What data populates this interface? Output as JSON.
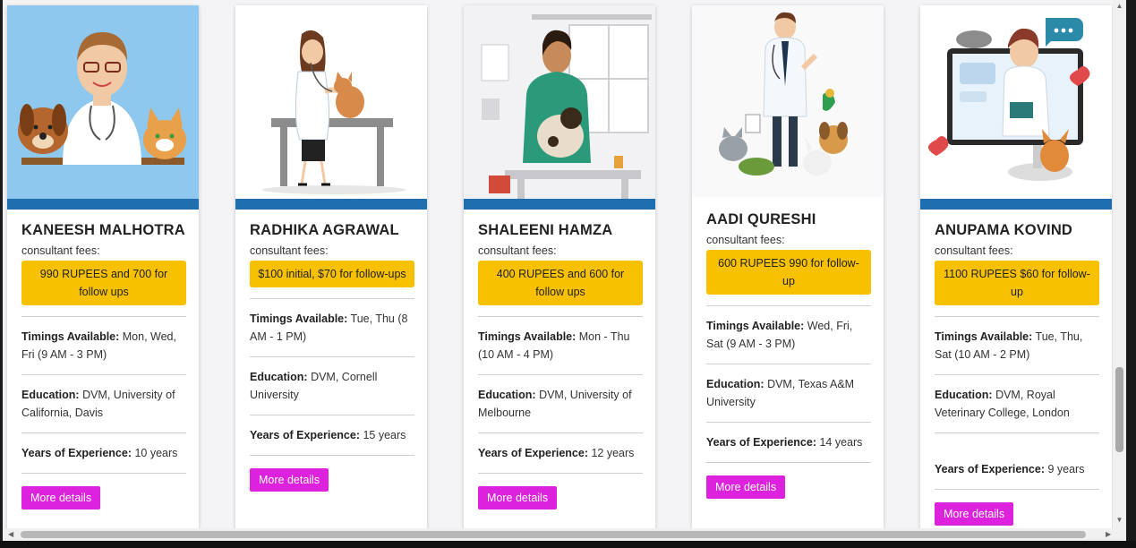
{
  "cards": [
    {
      "name": "KANEESH MALHOTRA",
      "fees_label": "consultant fees:",
      "fees": "990 RUPEES and 700 for follow ups",
      "timings_label": "Timings Available:",
      "timings": " Mon, Wed, Fri (9 AM - 3 PM)",
      "education_label": "Education:",
      "education": " DVM, University of California, Davis",
      "experience_label": "Years of Experience:",
      "experience": " 10 years",
      "button": "More details"
    },
    {
      "name": "RADHIKA AGRAWAL",
      "fees_label": "consultant fees:",
      "fees": "$100 initial, $70 for follow-ups",
      "timings_label": "Timings Available:",
      "timings": " Tue, Thu (8 AM - 1 PM)",
      "education_label": "Education:",
      "education": " DVM, Cornell University",
      "experience_label": "Years of Experience:",
      "experience": " 15 years",
      "button": "More details"
    },
    {
      "name": "SHALEENI HAMZA",
      "fees_label": "consultant fees:",
      "fees": "400 RUPEES and 600 for follow ups",
      "timings_label": "Timings Available:",
      "timings": " Mon - Thu (10 AM - 4 PM)",
      "education_label": "Education:",
      "education": " DVM, University of Melbourne",
      "experience_label": "Years of Experience:",
      "experience": " 12 years",
      "button": "More details"
    },
    {
      "name": "AADI QURESHI",
      "fees_label": "consultant fees:",
      "fees": "600 RUPEES 990 for follow-up",
      "timings_label": "Timings Available:",
      "timings": " Wed, Fri, Sat (9 AM - 3 PM)",
      "education_label": "Education:",
      "education": " DVM, Texas A&M University",
      "experience_label": "Years of Experience:",
      "experience": " 14 years",
      "button": "More details"
    },
    {
      "name": "ANUPAMA KOVIND",
      "fees_label": "consultant fees:",
      "fees": "1100 RUPEES $60 for follow-up",
      "timings_label": "Timings Available:",
      "timings": " Tue, Thu, Sat (10 AM - 2 PM)",
      "education_label": "Education:",
      "education": " DVM, Royal Veterinary College, London",
      "experience_label": "Years of Experience:",
      "experience": " 9 years",
      "button": "More details"
    }
  ],
  "images": [
    {
      "icon": "vet-with-dog-and-cat-illustration",
      "bg": "#8fc8ee"
    },
    {
      "icon": "vet-examining-cat-illustration",
      "bg": "#ffffff"
    },
    {
      "icon": "vet-holding-dog-illustration",
      "bg": "#f2f2f4"
    },
    {
      "icon": "vet-with-pets-illustration",
      "bg": "#f9f9f9"
    },
    {
      "icon": "online-vet-consultation-illustration",
      "bg": "#ffffff"
    }
  ],
  "colors": {
    "fee_box": "#f7c100",
    "button": "#dd22dd",
    "image_footer_strip": "#1f6fb0"
  }
}
